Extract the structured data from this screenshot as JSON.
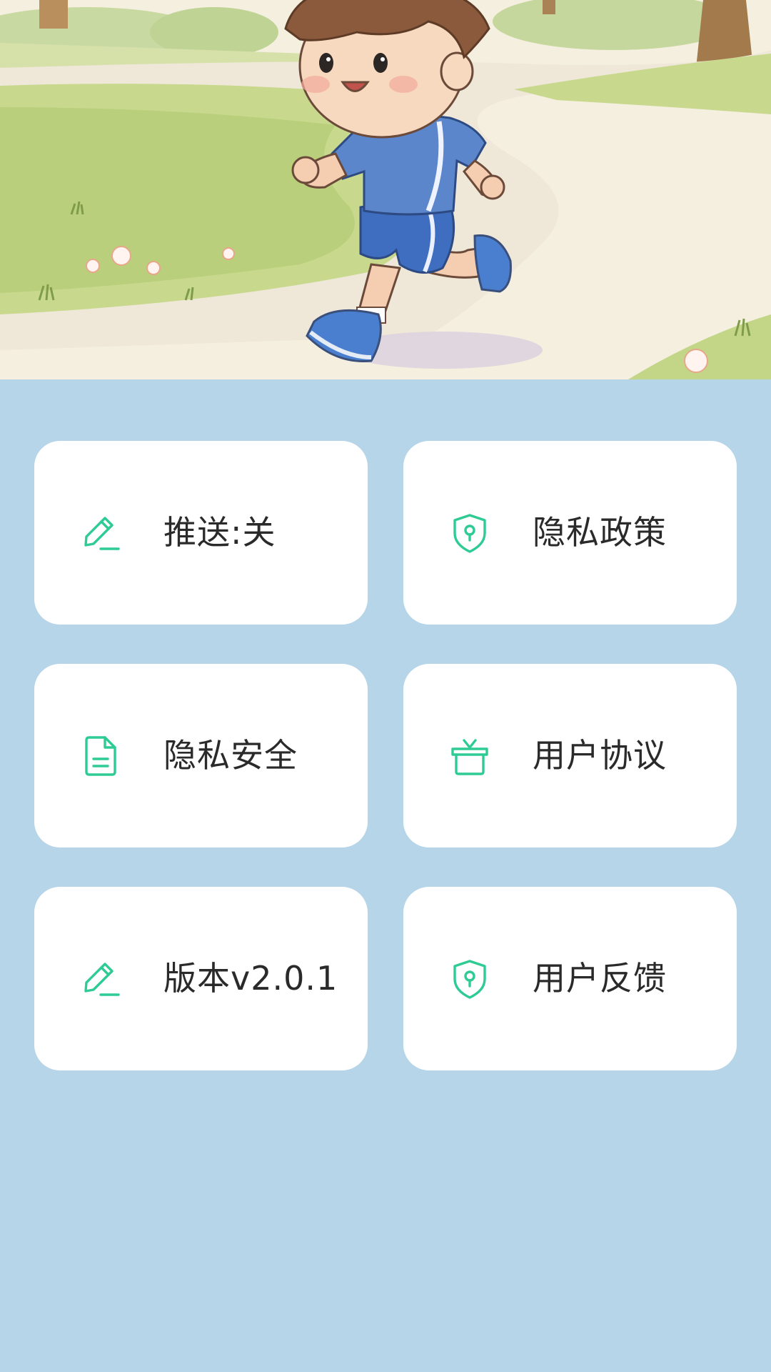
{
  "hero": {
    "icon": "running-boy-illustration"
  },
  "colors": {
    "background": "#b7d5e8",
    "card": "#ffffff",
    "icon_accent": "#2ecc94",
    "label_text": "#2a2a2a"
  },
  "settings": {
    "items": [
      {
        "label": "推送:关",
        "icon": "pencil-icon"
      },
      {
        "label": "隐私政策",
        "icon": "shield-lock-icon"
      },
      {
        "label": "隐私安全",
        "icon": "document-icon"
      },
      {
        "label": "用户协议",
        "icon": "gift-box-icon"
      },
      {
        "label": "版本v2.0.1",
        "icon": "pencil-icon"
      },
      {
        "label": "用户反馈",
        "icon": "shield-lock-icon"
      }
    ]
  }
}
